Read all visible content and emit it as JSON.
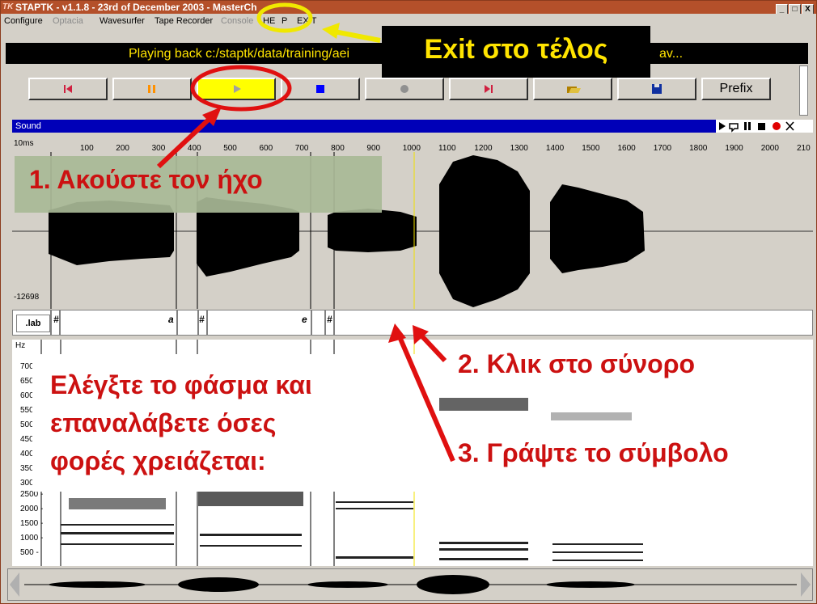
{
  "window": {
    "title": "STAPTK - v1.1.8 - 23rd of December 2003 - MasterCh",
    "app_icon": "TK",
    "buttons": [
      "_",
      "□",
      "X"
    ]
  },
  "menu": {
    "items": [
      {
        "label": "Configure",
        "enabled": true
      },
      {
        "label": "Optacia",
        "enabled": false
      },
      {
        "label": "Wavesurfer",
        "enabled": true
      },
      {
        "label": "Tape Recorder",
        "enabled": true
      },
      {
        "label": "Console",
        "enabled": false
      },
      {
        "label": "HE",
        "enabled": true
      },
      {
        "label": "P",
        "enabled": true
      },
      {
        "label": "EXIT",
        "enabled": true
      }
    ]
  },
  "status": {
    "text": "Playing back c:/staptk/data/training/aei",
    "tail": "av..."
  },
  "toolbar": {
    "buttons": [
      {
        "name": "rewind-button",
        "icon": "skip-back-icon"
      },
      {
        "name": "pause-button",
        "icon": "pause-icon"
      },
      {
        "name": "play-button",
        "icon": "play-icon",
        "active": true
      },
      {
        "name": "stop-button",
        "icon": "stop-icon"
      },
      {
        "name": "record-button",
        "icon": "record-icon"
      },
      {
        "name": "skip-forward-button",
        "icon": "skip-forward-icon"
      },
      {
        "name": "open-button",
        "icon": "folder-open-icon"
      },
      {
        "name": "save-button",
        "icon": "floppy-disk-icon"
      }
    ],
    "prefix_label": "Prefix"
  },
  "sound": {
    "header_label": "Sound",
    "ruler_unit": "10ms",
    "ruler_marks": [
      "100",
      "200",
      "300",
      "400",
      "500",
      "600",
      "700",
      "800",
      "900",
      "1000",
      "1100",
      "1200",
      "1300",
      "1400",
      "1500",
      "1600",
      "1700",
      "1800",
      "1900",
      "2000",
      "210"
    ],
    "wave_min_label": "-12698"
  },
  "labels": {
    "tier": ".lab",
    "segments": [
      "#",
      "a",
      "#",
      "e",
      "#"
    ]
  },
  "spectrogram": {
    "unit": "Hz",
    "left_ticks": [
      "700",
      "650",
      "600",
      "550",
      "500",
      "450",
      "400",
      "350",
      "300"
    ],
    "ticks": [
      "2500",
      "2000",
      "1500",
      "1000",
      "500"
    ]
  },
  "annotations": {
    "exit": "Exit στο τέλος",
    "step1": "1. Ακούστε τον ήχο",
    "step2": "2. Κλικ στο σύνορο",
    "step3": "3. Γράψτε το σύμβολο",
    "check_line1": "Ελέγξτε το φάσμα και",
    "check_line2": "επαναλάβετε όσες",
    "check_line3": "φορές χρειάζεται:"
  },
  "colors": {
    "titlebar": "#b4502a",
    "status_text": "#ffe400",
    "annotation_red": "#dd1111",
    "highlight_yellow": "#ffff00",
    "sound_header": "#0000b8"
  }
}
